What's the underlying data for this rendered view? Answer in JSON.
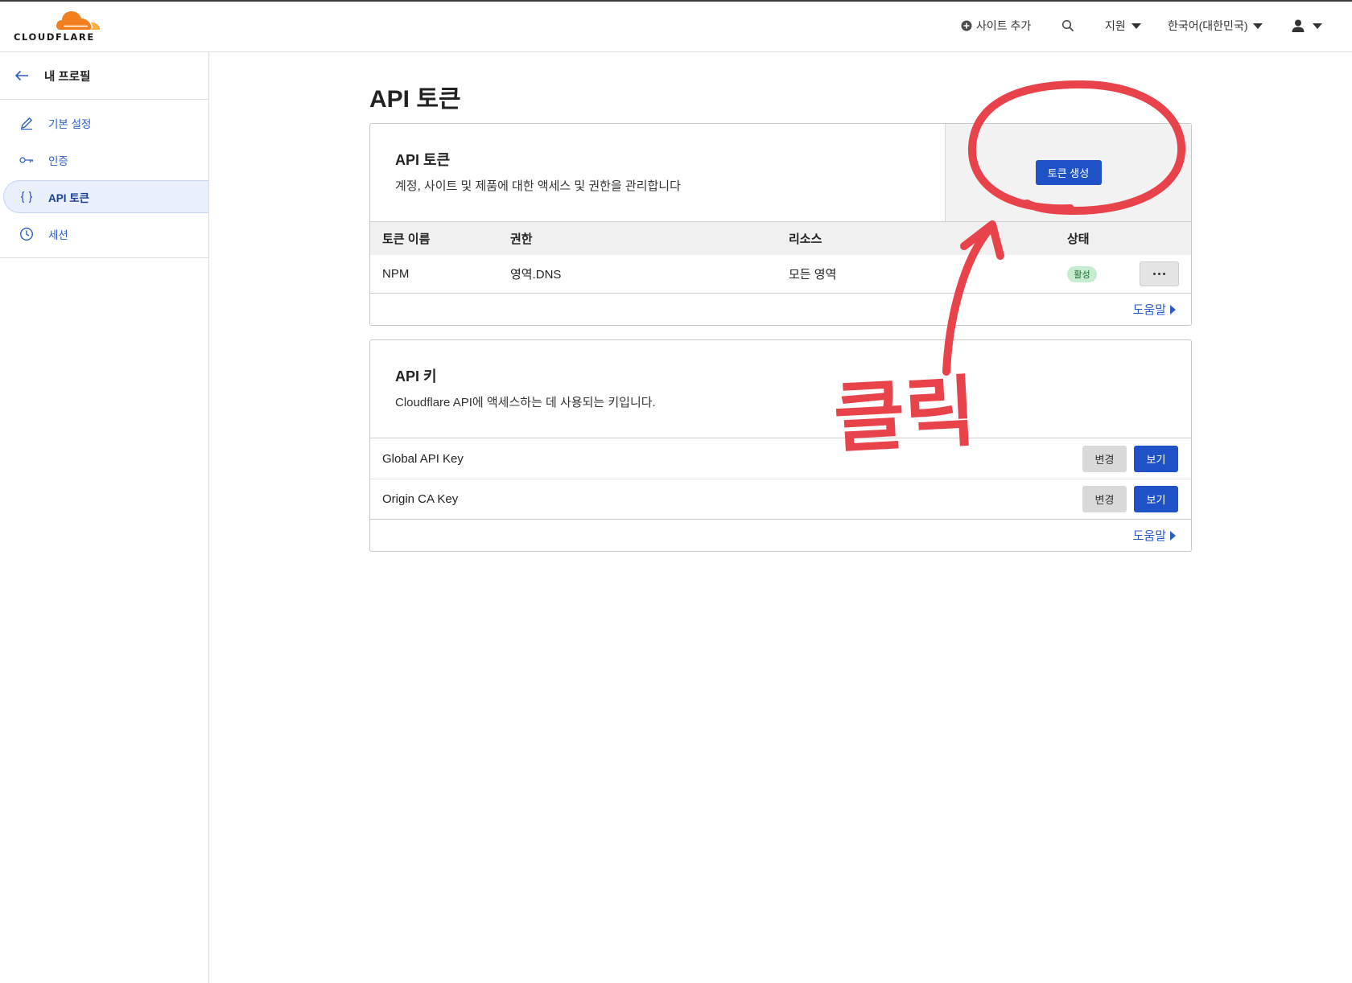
{
  "header": {
    "logo_text": "CLOUDFLARE",
    "add_site": "사이트 추가",
    "support": "지원",
    "language": "한국어(대한민국)",
    "icons": [
      "plus-circle-icon",
      "search-icon",
      "caret-down-icon",
      "user-icon"
    ]
  },
  "sidebar": {
    "back_label": "내 프로필",
    "items": [
      {
        "label": "기본 설정",
        "icon": "pencil-icon"
      },
      {
        "label": "인증",
        "icon": "key-icon"
      },
      {
        "label": "API 토큰",
        "icon": "braces-icon",
        "active": true
      },
      {
        "label": "세션",
        "icon": "clock-icon"
      }
    ]
  },
  "main": {
    "title": "API 토큰",
    "tokens_card": {
      "title": "API 토큰",
      "description": "계정, 사이트 및 제품에 대한 액세스 및 권한을 관리합니다",
      "create_button": "토큰 생성",
      "columns": [
        "토큰 이름",
        "권한",
        "리소스",
        "상태"
      ],
      "rows": [
        {
          "name": "NPM",
          "permission": "영역.DNS",
          "resource": "모든 영역",
          "status": "활성",
          "menu_icon": "ellipsis-icon"
        }
      ],
      "help": "도움말"
    },
    "keys_card": {
      "title": "API 키",
      "description": "Cloudflare API에 액세스하는 데 사용되는 키입니다.",
      "rows": [
        {
          "name": "Global API Key",
          "change": "변경",
          "view": "보기"
        },
        {
          "name": "Origin CA Key",
          "change": "변경",
          "view": "보기"
        }
      ],
      "help": "도움말"
    }
  },
  "annotation": {
    "text": "클릭",
    "color": "#e8434b"
  },
  "colors": {
    "primary_button": "#1f52c6",
    "link": "#2c5cc5",
    "logo_orange": "#f38020",
    "logo_light_orange": "#fbad41",
    "active_badge_bg": "#c6ecd0"
  }
}
